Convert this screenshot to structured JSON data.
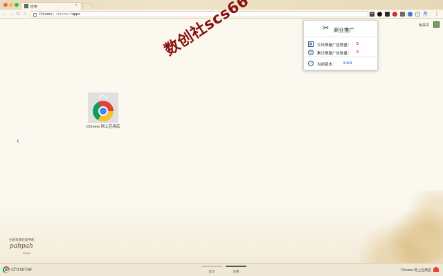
{
  "window": {
    "tab_title": "应用",
    "tab_close": "×"
  },
  "toolbar": {
    "back": "←",
    "forward": "→",
    "reload": "C",
    "home": "⌂",
    "site_label": "Chrome",
    "url_prefix": "chrome://",
    "url_path": "apps",
    "bookmark_star": "☆",
    "active_extension_glyph": "✂",
    "vpn_extension_glyph": "V",
    "menu_glyph": "⋮"
  },
  "user": {
    "name": "张昊中"
  },
  "popup": {
    "logo_glyph": "✂",
    "title": "商业推广",
    "stats": [
      {
        "icon": "calendar-icon",
        "label": "今日屏蔽广告数量：",
        "value": "0"
      },
      {
        "icon": "clock-icon",
        "label": "累计屏蔽广告数量：",
        "value": "0"
      }
    ],
    "version_label": "当前版本：",
    "version_value": "2.0.0",
    "info_glyph": "i"
  },
  "watermark": {
    "text": "数创社scs66"
  },
  "apps": [
    {
      "name": "Chrome 网上应用店"
    }
  ],
  "navigation": {
    "prev_arrow": "‹"
  },
  "theme_credit": {
    "label": "主题背景的提供者：",
    "brand": "pahpah",
    "brand_sub": "Design"
  },
  "bottom_bar": {
    "brand": "chrome",
    "pages": [
      {
        "label": "首页",
        "active": false
      },
      {
        "label": "应用",
        "active": true
      }
    ],
    "store_link": "Chrome 网上应用店"
  }
}
